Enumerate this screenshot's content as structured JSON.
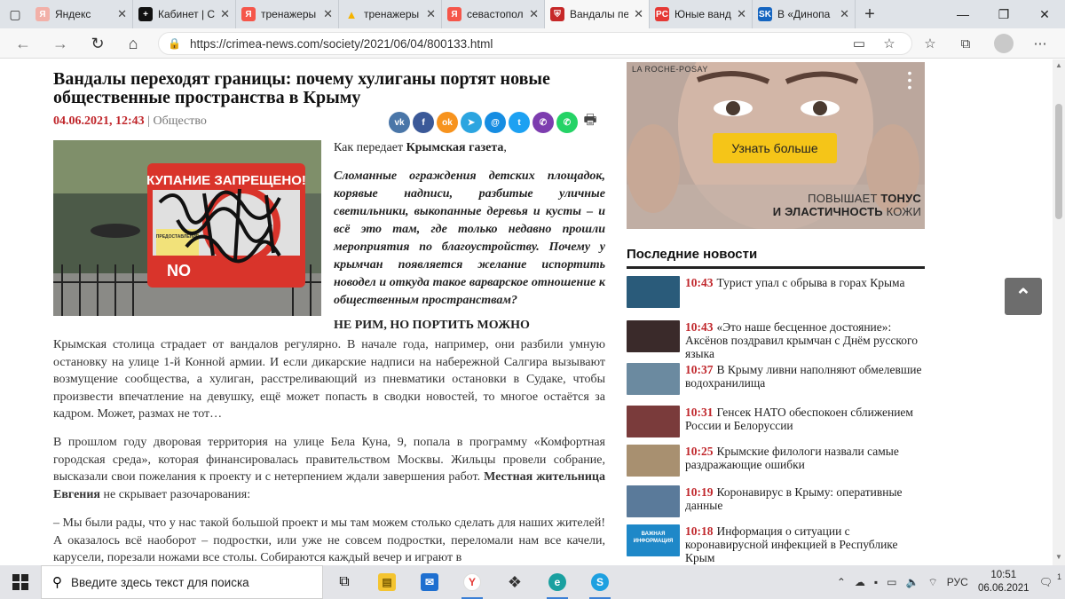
{
  "browser": {
    "tabs": [
      {
        "label": "Яндекс",
        "favicon": "yandex-icon",
        "color": "#f2b0a8",
        "active": false
      },
      {
        "label": "Кабинет | С",
        "favicon": "plus-circle-icon",
        "color": "#111111",
        "active": false
      },
      {
        "label": "тренажеры",
        "favicon": "yandex-icon",
        "color": "#f5564a",
        "active": false
      },
      {
        "label": "тренажеры",
        "favicon": "warning-icon",
        "color": "#f5b300",
        "active": false
      },
      {
        "label": "севастопол",
        "favicon": "yandex-icon",
        "color": "#f5564a",
        "active": false
      },
      {
        "label": "Вандалы пе",
        "favicon": "crest-icon",
        "color": "#c62828",
        "active": true
      },
      {
        "label": "Юные ванд",
        "favicon": "pc-icon",
        "color": "#e53935",
        "active": false
      },
      {
        "label": "В «Динопа",
        "favicon": "sk-icon",
        "color": "#1565c0",
        "active": false
      }
    ],
    "url": "https://crimea-news.com/society/2021/06/04/800133.html"
  },
  "article": {
    "title": "Вандалы переходят границы: почему хулиганы портят новые общественные пространства в Крыму",
    "date": "04.06.2021, 12:43",
    "separator": " | ",
    "category": "Общество",
    "lead_prefix": "Как передает ",
    "lead_source": "Крымская газета",
    "lead_suffix": ",",
    "lead": "Сломанные ограждения детских площадок, корявые надписи, разбитые уличные светильники, выкопанные деревья и кусты – и всё это там, где только недавно прошли мероприятия по благоустройству. Почему у крымчан появляется желание испортить новодел и откуда такое варварское отношение к общественным пространствам?",
    "subhead": "НЕ РИМ, НО ПОРТИТЬ МОЖНО",
    "subhead_tail": "Крымская столица страдает от вандалов регулярно. В начале года, например, они разбили умную остановку на улице 1-й Конной армии. И если дикарские надписи на набережной Салгира вызывают возмущение сообщества, а хулиган, расстреливающий из пневматики остановки в Судаке, чтобы произвести впечатление на девушку, ещё может попасть в сводки новостей, то многое остаётся за кадром. Может, размах не тот…",
    "para2_a": "В прошлом году дворовая территория на улице Бела Куна, 9, попала в программу «Комфортная городская среда», которая финансировалась правительством Москвы. Жильцы провели собрание, высказали свои пожелания к проекту и с нетерпением ждали завершения работ. ",
    "para2_bold": "Местная жительница Евгения",
    "para2_b": " не скрывает разочарования:",
    "para3": "– Мы были рады, что у нас такой большой проект и мы там можем столько сделать для наших жителей! А оказалось всё наоборот – подростки, или уже не совсем подростки, переломали нам все качели, карусели, порезали ножами все столы. Собираются каждый вечер и играют в",
    "photo_sign_top": "КУПАНИЕ ЗАПРЕЩЕНО!",
    "photo_sign_bottom": "NO",
    "photo_sign_notice": "ПРЕДОСТАВЛЕНИЕ"
  },
  "share": [
    {
      "name": "vk",
      "icon": "vk-icon",
      "text": "vk",
      "color": "#4a76a8"
    },
    {
      "name": "facebook",
      "icon": "facebook-icon",
      "text": "f",
      "color": "#3b5998"
    },
    {
      "name": "odnoklassniki",
      "icon": "odnoklassniki-icon",
      "text": "ok",
      "color": "#f7931e"
    },
    {
      "name": "telegram",
      "icon": "telegram-icon",
      "text": "➤",
      "color": "#2ca5e0"
    },
    {
      "name": "moimir",
      "icon": "moimir-icon",
      "text": "@",
      "color": "#168de2"
    },
    {
      "name": "twitter",
      "icon": "twitter-icon",
      "text": "t",
      "color": "#1da1f2"
    },
    {
      "name": "viber",
      "icon": "viber-icon",
      "text": "✆",
      "color": "#7d3daf"
    },
    {
      "name": "whatsapp",
      "icon": "whatsapp-icon",
      "text": "✆",
      "color": "#25d366"
    }
  ],
  "ad": {
    "brand": "LA ROCHE-POSAY",
    "cta": "Узнать больше",
    "text_a": "ПОВЫШАЕТ ",
    "text_b": "ТОНУС",
    "text_c": "И ЭЛАСТИЧНОСТЬ",
    "text_d": " КОЖИ"
  },
  "news": {
    "title": "Последние новости",
    "items": [
      {
        "time": "10:43",
        "text": "Турист упал с обрыва в горах Крыма",
        "thumb": "#2a5b7a"
      },
      {
        "time": "10:43",
        "text": "«Это наше бесценное достояние»: Аксёнов поздравил крымчан с Днём русского языка",
        "thumb": "#3a2a2a"
      },
      {
        "time": "10:37",
        "text": "В Крыму ливни наполняют обмелевшие водохранилища",
        "thumb": "#6b8aa0"
      },
      {
        "time": "10:31",
        "text": "Генсек НАТО обеспокоен сближением России и Белоруссии",
        "thumb": "#7a3b3b"
      },
      {
        "time": "10:25",
        "text": "Крымские филологи назвали самые раздражающие ошибки",
        "thumb": "#a89070"
      },
      {
        "time": "10:19",
        "text": "Коронавирус в Крыму: оперативные данные",
        "thumb": "#5a7a9a"
      },
      {
        "time": "10:18",
        "text": "Информация о ситуации с коронавирусной инфекцией в Республике Крым",
        "thumb": "#1e88c8",
        "thumb_text": "ВАЖНАЯ ИНФОРМАЦИЯ"
      }
    ]
  },
  "taskbar": {
    "search_placeholder": "Введите здесь текст для поиска",
    "lang": "РУС",
    "time": "10:51",
    "date": "06.06.2021",
    "notifications": "1"
  }
}
